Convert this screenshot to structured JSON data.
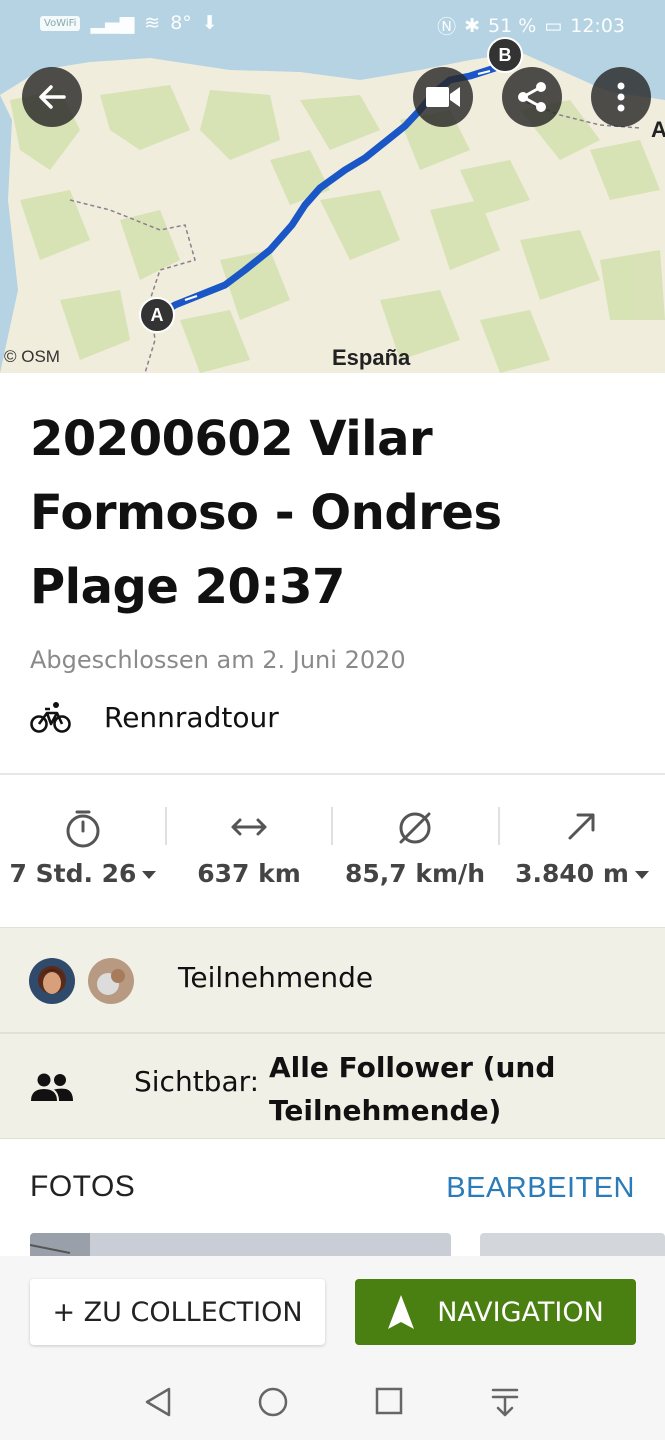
{
  "status_bar": {
    "left_badge": "VoWiFi",
    "temperature": "8°",
    "battery_percent": "51 %",
    "time": "12:03"
  },
  "map": {
    "copyright": "© OSM",
    "country_label": "España",
    "edge_label": "A",
    "marker_start": "A",
    "marker_end": "B",
    "route_color": "#1a56c6"
  },
  "map_controls": {
    "back_icon": "arrow-left-icon",
    "video_icon": "video-camera-icon",
    "share_icon": "share-icon",
    "more_icon": "more-vertical-icon"
  },
  "tour": {
    "title": "20200602 Vilar Formoso - Ondres Plage 20:37",
    "completed": "Abgeschlossen am 2. Juni 2020",
    "sport_icon": "road-bike-icon",
    "sport": "Rennradtour"
  },
  "stats": [
    {
      "icon": "stopwatch-icon",
      "value": "7 Std. 26",
      "dropdown": true
    },
    {
      "icon": "horizontal-arrows-icon",
      "value": "637 km",
      "dropdown": false
    },
    {
      "icon": "average-speed-icon",
      "value": "85,7 km/h",
      "dropdown": false
    },
    {
      "icon": "ascent-arrow-icon",
      "value": "3.840 m",
      "dropdown": true
    }
  ],
  "participants": {
    "label": "Teilnehmende"
  },
  "visibility": {
    "icon": "people-icon",
    "label": "Sichtbar:",
    "value": "Alle Follower (und Teilnehmende)"
  },
  "photos": {
    "heading": "FOTOS",
    "edit": "BEARBEITEN"
  },
  "actions": {
    "collection": "+ ZU COLLECTION",
    "navigation": "NAVIGATION"
  },
  "colors": {
    "accent_green": "#4a7f12",
    "link_blue": "#2a7bb8",
    "beige": "#f1f0e7"
  }
}
